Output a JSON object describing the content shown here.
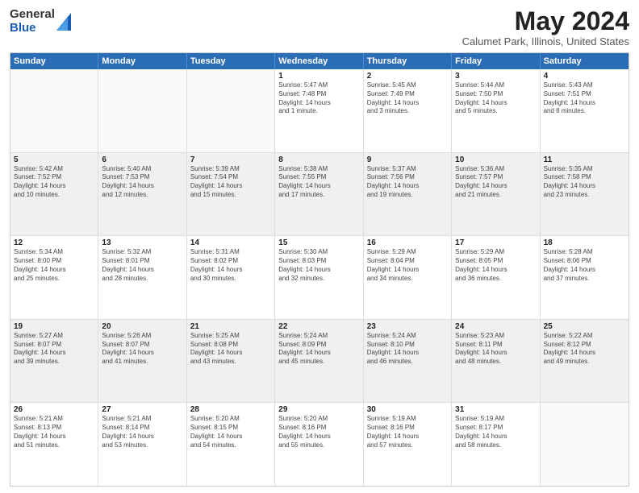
{
  "logo": {
    "general": "General",
    "blue": "Blue"
  },
  "title": "May 2024",
  "location": "Calumet Park, Illinois, United States",
  "days_of_week": [
    "Sunday",
    "Monday",
    "Tuesday",
    "Wednesday",
    "Thursday",
    "Friday",
    "Saturday"
  ],
  "weeks": [
    [
      {
        "day": "",
        "info": "",
        "empty": true
      },
      {
        "day": "",
        "info": "",
        "empty": true
      },
      {
        "day": "",
        "info": "",
        "empty": true
      },
      {
        "day": "1",
        "info": "Sunrise: 5:47 AM\nSunset: 7:48 PM\nDaylight: 14 hours\nand 1 minute."
      },
      {
        "day": "2",
        "info": "Sunrise: 5:45 AM\nSunset: 7:49 PM\nDaylight: 14 hours\nand 3 minutes."
      },
      {
        "day": "3",
        "info": "Sunrise: 5:44 AM\nSunset: 7:50 PM\nDaylight: 14 hours\nand 5 minutes."
      },
      {
        "day": "4",
        "info": "Sunrise: 5:43 AM\nSunset: 7:51 PM\nDaylight: 14 hours\nand 8 minutes."
      }
    ],
    [
      {
        "day": "5",
        "info": "Sunrise: 5:42 AM\nSunset: 7:52 PM\nDaylight: 14 hours\nand 10 minutes."
      },
      {
        "day": "6",
        "info": "Sunrise: 5:40 AM\nSunset: 7:53 PM\nDaylight: 14 hours\nand 12 minutes."
      },
      {
        "day": "7",
        "info": "Sunrise: 5:39 AM\nSunset: 7:54 PM\nDaylight: 14 hours\nand 15 minutes."
      },
      {
        "day": "8",
        "info": "Sunrise: 5:38 AM\nSunset: 7:55 PM\nDaylight: 14 hours\nand 17 minutes."
      },
      {
        "day": "9",
        "info": "Sunrise: 5:37 AM\nSunset: 7:56 PM\nDaylight: 14 hours\nand 19 minutes."
      },
      {
        "day": "10",
        "info": "Sunrise: 5:36 AM\nSunset: 7:57 PM\nDaylight: 14 hours\nand 21 minutes."
      },
      {
        "day": "11",
        "info": "Sunrise: 5:35 AM\nSunset: 7:58 PM\nDaylight: 14 hours\nand 23 minutes."
      }
    ],
    [
      {
        "day": "12",
        "info": "Sunrise: 5:34 AM\nSunset: 8:00 PM\nDaylight: 14 hours\nand 25 minutes."
      },
      {
        "day": "13",
        "info": "Sunrise: 5:32 AM\nSunset: 8:01 PM\nDaylight: 14 hours\nand 28 minutes."
      },
      {
        "day": "14",
        "info": "Sunrise: 5:31 AM\nSunset: 8:02 PM\nDaylight: 14 hours\nand 30 minutes."
      },
      {
        "day": "15",
        "info": "Sunrise: 5:30 AM\nSunset: 8:03 PM\nDaylight: 14 hours\nand 32 minutes."
      },
      {
        "day": "16",
        "info": "Sunrise: 5:29 AM\nSunset: 8:04 PM\nDaylight: 14 hours\nand 34 minutes."
      },
      {
        "day": "17",
        "info": "Sunrise: 5:29 AM\nSunset: 8:05 PM\nDaylight: 14 hours\nand 36 minutes."
      },
      {
        "day": "18",
        "info": "Sunrise: 5:28 AM\nSunset: 8:06 PM\nDaylight: 14 hours\nand 37 minutes."
      }
    ],
    [
      {
        "day": "19",
        "info": "Sunrise: 5:27 AM\nSunset: 8:07 PM\nDaylight: 14 hours\nand 39 minutes."
      },
      {
        "day": "20",
        "info": "Sunrise: 5:26 AM\nSunset: 8:07 PM\nDaylight: 14 hours\nand 41 minutes."
      },
      {
        "day": "21",
        "info": "Sunrise: 5:25 AM\nSunset: 8:08 PM\nDaylight: 14 hours\nand 43 minutes."
      },
      {
        "day": "22",
        "info": "Sunrise: 5:24 AM\nSunset: 8:09 PM\nDaylight: 14 hours\nand 45 minutes."
      },
      {
        "day": "23",
        "info": "Sunrise: 5:24 AM\nSunset: 8:10 PM\nDaylight: 14 hours\nand 46 minutes."
      },
      {
        "day": "24",
        "info": "Sunrise: 5:23 AM\nSunset: 8:11 PM\nDaylight: 14 hours\nand 48 minutes."
      },
      {
        "day": "25",
        "info": "Sunrise: 5:22 AM\nSunset: 8:12 PM\nDaylight: 14 hours\nand 49 minutes."
      }
    ],
    [
      {
        "day": "26",
        "info": "Sunrise: 5:21 AM\nSunset: 8:13 PM\nDaylight: 14 hours\nand 51 minutes."
      },
      {
        "day": "27",
        "info": "Sunrise: 5:21 AM\nSunset: 8:14 PM\nDaylight: 14 hours\nand 53 minutes."
      },
      {
        "day": "28",
        "info": "Sunrise: 5:20 AM\nSunset: 8:15 PM\nDaylight: 14 hours\nand 54 minutes."
      },
      {
        "day": "29",
        "info": "Sunrise: 5:20 AM\nSunset: 8:16 PM\nDaylight: 14 hours\nand 55 minutes."
      },
      {
        "day": "30",
        "info": "Sunrise: 5:19 AM\nSunset: 8:16 PM\nDaylight: 14 hours\nand 57 minutes."
      },
      {
        "day": "31",
        "info": "Sunrise: 5:19 AM\nSunset: 8:17 PM\nDaylight: 14 hours\nand 58 minutes."
      },
      {
        "day": "",
        "info": "",
        "empty": true
      }
    ]
  ]
}
